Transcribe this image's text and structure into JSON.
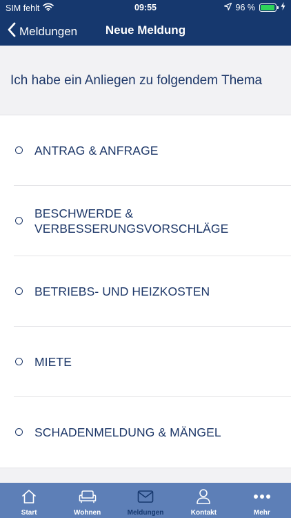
{
  "status_bar": {
    "carrier": "SIM fehlt",
    "time": "09:55",
    "battery": "96 %",
    "battery_level": 0.96,
    "icons": [
      "wifi-icon",
      "location-arrow-icon",
      "battery-icon",
      "charging-bolt-icon"
    ]
  },
  "nav": {
    "back_label": "Meldungen",
    "title": "Neue Meldung",
    "back_icon": "chevron-left-icon"
  },
  "prompt": "Ich habe ein Anliegen zu folgendem Thema",
  "topics": [
    {
      "label": "ANTRAG & ANFRAGE",
      "selected": false
    },
    {
      "label": "BESCHWERDE & VERBESSERUNGSVORSCHLÄGE",
      "selected": false
    },
    {
      "label": "BETRIEBS- UND HEIZKOSTEN",
      "selected": false
    },
    {
      "label": "MIETE",
      "selected": false
    },
    {
      "label": "SCHADENMELDUNG & MÄNGEL",
      "selected": false
    }
  ],
  "tabs": [
    {
      "label": "Start",
      "icon": "home-icon",
      "active": false
    },
    {
      "label": "Wohnen",
      "icon": "sofa-icon",
      "active": false
    },
    {
      "label": "Meldungen",
      "icon": "envelope-icon",
      "active": true
    },
    {
      "label": "Kontakt",
      "icon": "person-icon",
      "active": false
    },
    {
      "label": "Mehr",
      "icon": "more-dots-icon",
      "active": false
    }
  ],
  "colors": {
    "header_bg": "#16386e",
    "tabbar_bg": "#5d7fb7",
    "text_primary": "#1d3768",
    "section_bg": "#f2f2f4",
    "battery_fill": "#2ed35a"
  }
}
